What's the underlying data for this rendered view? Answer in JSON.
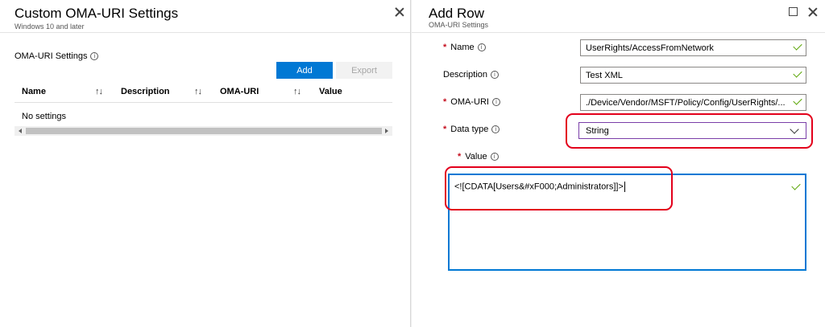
{
  "left_blade": {
    "title": "Custom OMA-URI Settings",
    "subtitle": "Windows 10 and later",
    "section_label": "OMA-URI Settings",
    "info_glyph": "i",
    "add_label": "Add",
    "export_label": "Export",
    "columns": [
      {
        "label": "Name",
        "sort": "↑↓"
      },
      {
        "label": "Description",
        "sort": "↑↓"
      },
      {
        "label": "OMA-URI",
        "sort": "↑↓"
      },
      {
        "label": "Value"
      }
    ],
    "empty_text": "No settings"
  },
  "right_blade": {
    "title": "Add Row",
    "subtitle": "OMA-URI Settings",
    "required_marker": "*",
    "fields": {
      "name": {
        "label": "Name",
        "value": "UserRights/AccessFromNetwork",
        "required": true
      },
      "description": {
        "label": "Description",
        "value": "Test XML",
        "required": false
      },
      "oma_uri": {
        "label": "OMA-URI",
        "value": "./Device/Vendor/MSFT/Policy/Config/UserRights/...",
        "required": true
      },
      "data_type": {
        "label": "Data type",
        "value": "String",
        "required": true
      },
      "value": {
        "label": "Value",
        "value": "<![CDATA[Users&#xF000;Administrators]]>",
        "required": true
      }
    }
  },
  "colors": {
    "accent": "#0078d4",
    "required": "#c50f1f",
    "valid_check": "#57a300",
    "highlight": "#e3001b"
  },
  "icons": [
    "close-icon",
    "maximize-icon",
    "info-icon",
    "sort-icon",
    "checkmark-icon",
    "chevron-down-icon"
  ]
}
